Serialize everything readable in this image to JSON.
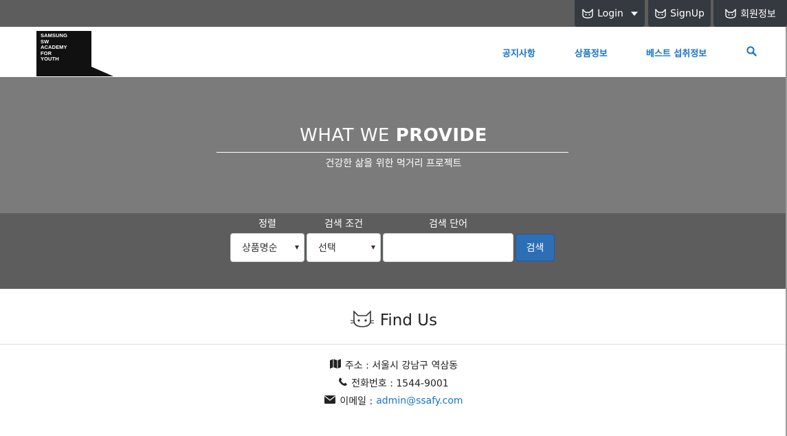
{
  "topbar": {
    "login_label": "Login",
    "signup_label": "SignUp",
    "member_info_label": "회원정보",
    "icon": "cat-icon"
  },
  "navbar": {
    "logo_lines": [
      "SAMSUNG",
      "SW",
      "ACADEMY",
      "FOR",
      "YOUTH"
    ],
    "links": [
      "공지사항",
      "상품정보",
      "베스트 섭취정보"
    ],
    "search_icon": "search-icon",
    "accent": "#1a73c8"
  },
  "hero": {
    "title_light": "WHAT WE ",
    "title_bold": "PROVIDE",
    "subtitle": "건강한 삶을 위한 먹거리 프로젝트"
  },
  "search": {
    "sort_label": "정렬",
    "sort_value": "상품명순",
    "condition_label": "검색 조건",
    "condition_value": "선택",
    "keyword_label": "검색 단어",
    "keyword_value": "",
    "button_label": "검색"
  },
  "footer": {
    "title": "Find Us",
    "address": "주소 : 서울시 강남구 역삼동",
    "phone": "전화번호 : 1544-9001",
    "email_label": "이메일 :",
    "email": "admin@ssafy.com"
  },
  "colors": {
    "topbar_bg": "#5d5d5d",
    "button_dark": "#343a40",
    "hero_bg": "#7b7b7b",
    "search_button": "#2c6fb6"
  }
}
